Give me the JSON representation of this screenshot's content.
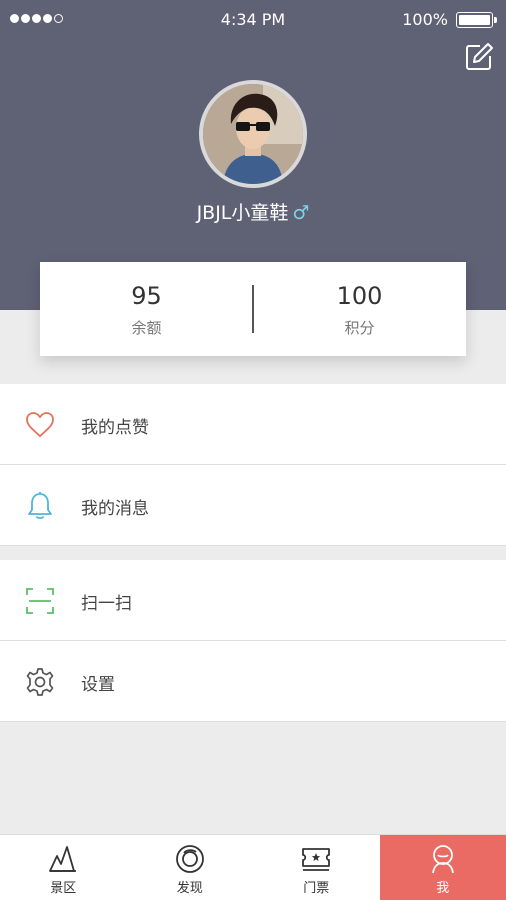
{
  "status_bar": {
    "time": "4:34 PM",
    "battery": "100%",
    "signal_bars": 5,
    "signal_filled": 4
  },
  "profile": {
    "username": "JBJL小童鞋",
    "gender_symbol": "♂"
  },
  "stats": [
    {
      "value": "95",
      "label": "余额"
    },
    {
      "value": "100",
      "label": "积分"
    }
  ],
  "menu": {
    "likes": "我的点赞",
    "messages": "我的消息",
    "scan": "扫一扫",
    "settings": "设置"
  },
  "tabbar": {
    "tabs": [
      {
        "label": "景区",
        "icon": "mountain-icon"
      },
      {
        "label": "发现",
        "icon": "lens-icon"
      },
      {
        "label": "门票",
        "icon": "ticket-icon"
      },
      {
        "label": "我",
        "icon": "person-icon"
      }
    ],
    "active_index": 3
  },
  "colors": {
    "header_bg": "#5f6175",
    "active_tab": "#e96b64",
    "heart": "#e2725b",
    "bell": "#4db6d8",
    "scan": "#5bbf6a",
    "gear": "#555555"
  }
}
